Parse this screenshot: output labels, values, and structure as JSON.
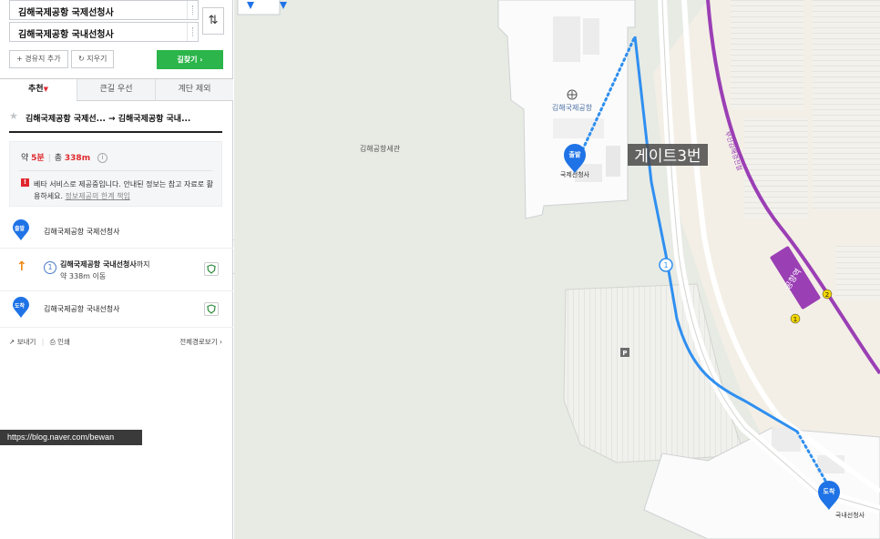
{
  "search": {
    "origin_value": "김해국제공항 국제선청사",
    "destination_value": "김해국제공항 국내선청사",
    "swap_icon": "swap-vertical-icon",
    "add_waypoint_label": "+ 경유지 추가",
    "clear_label": "지우기",
    "find_route_label": "길찾기 ›"
  },
  "tabs": [
    {
      "label": "추천"
    },
    {
      "label": "큰길 우선"
    },
    {
      "label": "계단 제외"
    }
  ],
  "route": {
    "title": "김해국제공항 국제선... → 김해국제공항 국내...",
    "time_prefix": "약",
    "time": "5분",
    "distance_prefix": "총",
    "distance": "338m",
    "beta_badge": "!",
    "beta_notice": "베타 서비스로 제공중입니다. 안내된 정보는 참고 자료로 활용하세요.",
    "beta_link": "정보제공의 한계 책임"
  },
  "steps": [
    {
      "pin": "출발",
      "label": "김해국제공항 국제선청사"
    },
    {
      "number": "1",
      "label_bold": "김해국제공항 국내선청사",
      "label_suffix": "까지",
      "sub": "약 338m 이동"
    },
    {
      "pin": "도착",
      "label": "김해국제공항 국내선청사"
    }
  ],
  "footer": {
    "send_label": "보내기",
    "print_label": "인쇄",
    "full_route_label": "전체경로보기 ›"
  },
  "url_overlay": "https://blog.naver.com/bewan",
  "map": {
    "customs_label": "김해공항세관",
    "airport_label": "김해국제공항",
    "departure_pin": "출발",
    "departure_label": "국제선청사",
    "gate_label": "게이트3번",
    "step_marker": "1",
    "arrival_pin": "도착",
    "arrival_label": "국내선청사",
    "station_label": "공항역",
    "line_label": "부산김해경전철",
    "parking_glyph": "P",
    "line1_badge": "1",
    "line2_badge": "2"
  },
  "colors": {
    "route_blue": "#2f8ff0",
    "green_button": "#2bb54a",
    "accent_red": "#e0282e",
    "light_rail_purple": "#9b3fb5"
  }
}
